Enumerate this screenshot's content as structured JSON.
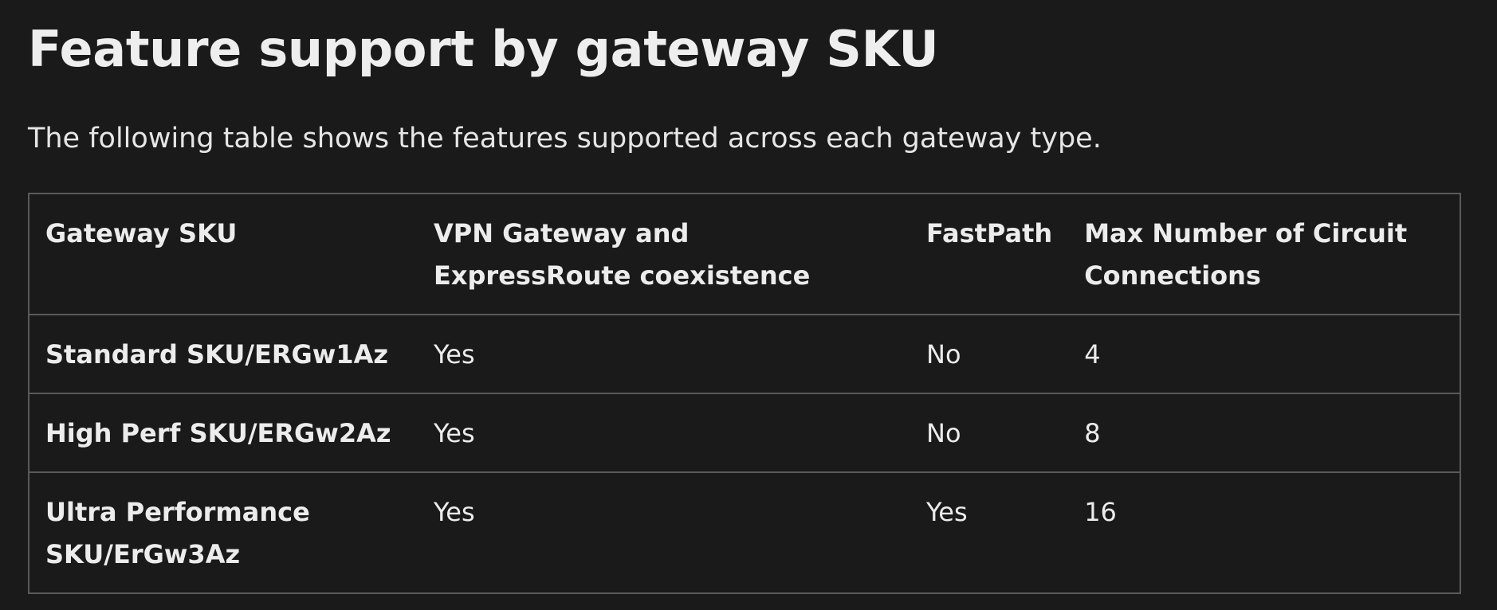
{
  "heading": "Feature support by gateway SKU",
  "intro": "The following table shows the features supported across each gateway type.",
  "table": {
    "headers": [
      "Gateway SKU",
      "VPN Gateway and ExpressRoute coexistence",
      "FastPath",
      "Max Number of Circuit Connections"
    ],
    "rows": [
      [
        "Standard SKU/ERGw1Az",
        "Yes",
        "No",
        "4"
      ],
      [
        "High Perf SKU/ERGw2Az",
        "Yes",
        "No",
        "8"
      ],
      [
        "Ultra Performance SKU/ErGw3Az",
        "Yes",
        "Yes",
        "16"
      ]
    ]
  }
}
